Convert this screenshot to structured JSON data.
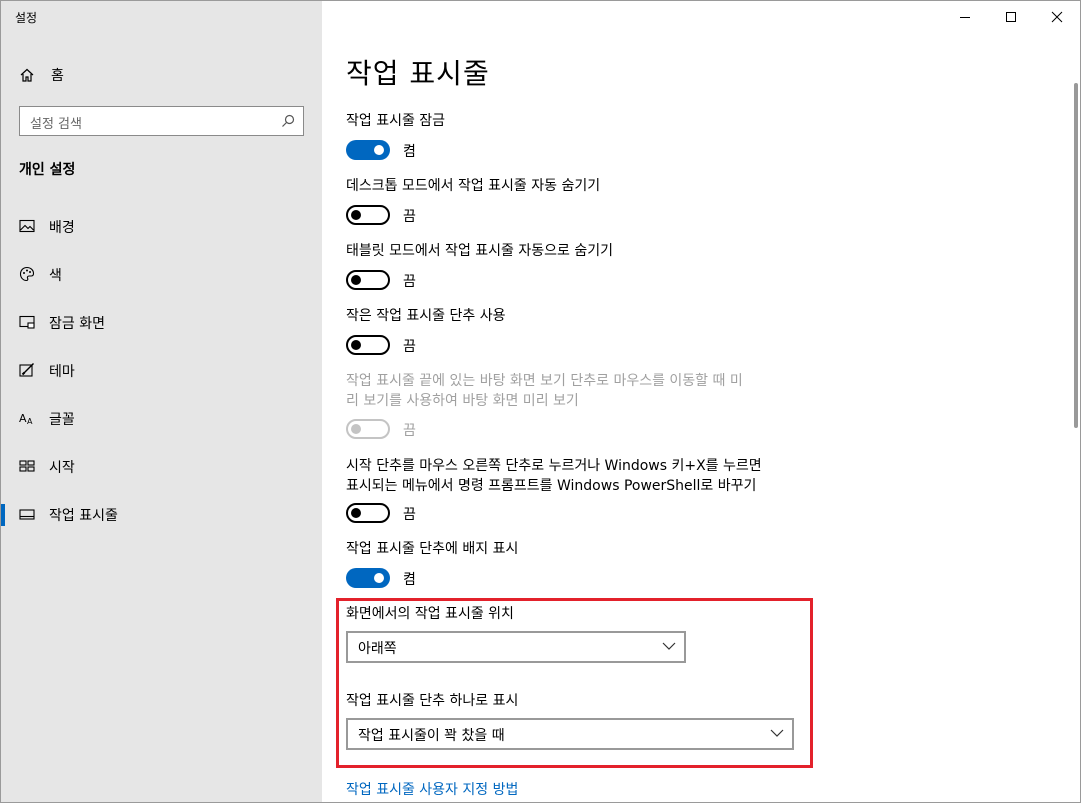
{
  "app": {
    "title": "설정"
  },
  "window_controls": {
    "minimize_icon": "minimize-icon",
    "maximize_icon": "maximize-icon",
    "close_icon": "close-icon"
  },
  "sidebar": {
    "home_label": "홈",
    "home_icon": "home-icon",
    "search_placeholder": "설정 검색",
    "search_icon": "search-icon",
    "section_title": "개인 설정",
    "items": [
      {
        "label": "배경",
        "icon": "image-icon"
      },
      {
        "label": "색",
        "icon": "palette-icon"
      },
      {
        "label": "잠금 화면",
        "icon": "lock-screen-icon"
      },
      {
        "label": "테마",
        "icon": "theme-icon"
      },
      {
        "label": "글꼴",
        "icon": "font-icon"
      },
      {
        "label": "시작",
        "icon": "start-icon"
      },
      {
        "label": "작업 표시줄",
        "icon": "taskbar-icon",
        "selected": true
      }
    ]
  },
  "main": {
    "title": "작업 표시줄",
    "settings": [
      {
        "label": "작업 표시줄 잠금",
        "state": "켬",
        "on": true,
        "disabled": false
      },
      {
        "label": "데스크톱 모드에서 작업 표시줄 자동 숨기기",
        "state": "끔",
        "on": false,
        "disabled": false
      },
      {
        "label": "태블릿 모드에서 작업 표시줄 자동으로 숨기기",
        "state": "끔",
        "on": false,
        "disabled": false
      },
      {
        "label": "작은 작업 표시줄 단추 사용",
        "state": "끔",
        "on": false,
        "disabled": false
      },
      {
        "label_line1": "작업 표시줄 끝에 있는 바탕 화면 보기 단추로 마우스를 이동할 때 미",
        "label_line2": "리 보기를 사용하여 바탕 화면 미리 보기",
        "state": "끔",
        "on": false,
        "disabled": true
      },
      {
        "label_line1": "시작 단추를 마우스 오른쪽 단추로 누르거나 Windows 키+X를 누르면",
        "label_line2": "표시되는 메뉴에서 명령 프롬프트를 Windows PowerShell로 바꾸기",
        "state": "끔",
        "on": false,
        "disabled": false
      },
      {
        "label": "작업 표시줄 단추에 배지 표시",
        "state": "켬",
        "on": true,
        "disabled": false
      }
    ],
    "position": {
      "label": "화면에서의 작업 표시줄 위치",
      "value": "아래쪽"
    },
    "combine": {
      "label": "작업 표시줄 단추 하나로 표시",
      "value": "작업 표시줄이 꽉 찼을 때"
    },
    "link": "작업 표시줄 사용자 지정 방법",
    "highlight_color": "#e3212b",
    "accent_color": "#0067c0"
  }
}
